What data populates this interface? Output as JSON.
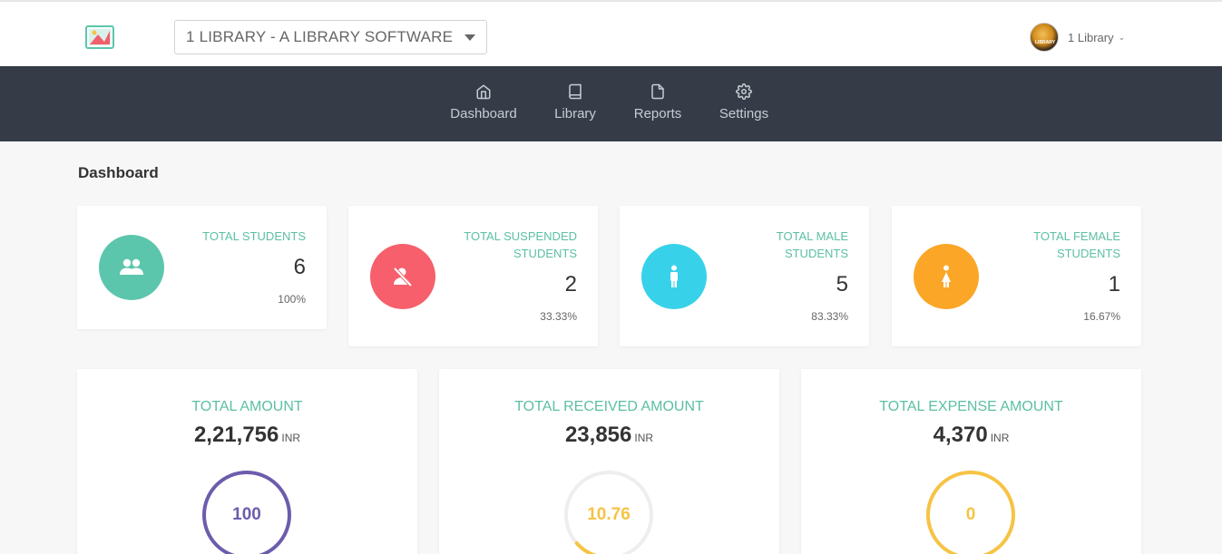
{
  "header": {
    "app_selector_value": "1 LIBRARY - A LIBRARY SOFTWARE",
    "user_name": "1 Library"
  },
  "nav": {
    "items": [
      {
        "label": "Dashboard",
        "icon": "home-icon"
      },
      {
        "label": "Library",
        "icon": "book-icon"
      },
      {
        "label": "Reports",
        "icon": "file-icon"
      },
      {
        "label": "Settings",
        "icon": "gear-icon"
      }
    ]
  },
  "page": {
    "title": "Dashboard"
  },
  "stats": [
    {
      "label_lines": [
        "TOTAL STUDENTS"
      ],
      "value": "6",
      "percent": "100%",
      "color": "#5cc6ad",
      "icon": "users-icon"
    },
    {
      "label_lines": [
        "TOTAL SUSPENDED",
        "STUDENTS"
      ],
      "value": "2",
      "percent": "33.33%",
      "color": "#f65f6b",
      "icon": "user-slash-icon"
    },
    {
      "label_lines": [
        "TOTAL MALE",
        "STUDENTS"
      ],
      "value": "5",
      "percent": "83.33%",
      "color": "#38d1ea",
      "icon": "male-icon"
    },
    {
      "label_lines": [
        "TOTAL FEMALE",
        "STUDENTS"
      ],
      "value": "1",
      "percent": "16.67%",
      "color": "#fba627",
      "icon": "female-icon"
    }
  ],
  "amounts": [
    {
      "title": "TOTAL AMOUNT",
      "value": "2,21,756",
      "currency": "INR",
      "gauge_value": "100",
      "gauge_fraction": 1.0,
      "color": "#6d5cad"
    },
    {
      "title": "TOTAL RECEIVED AMOUNT",
      "value": "23,856",
      "currency": "INR",
      "gauge_value": "10.76",
      "gauge_fraction": 0.1076,
      "color": "#f6c344"
    },
    {
      "title": "TOTAL EXPENSE AMOUNT",
      "value": "4,370",
      "currency": "INR",
      "gauge_value": "0",
      "gauge_fraction": 0,
      "color": "#f6c344"
    }
  ]
}
